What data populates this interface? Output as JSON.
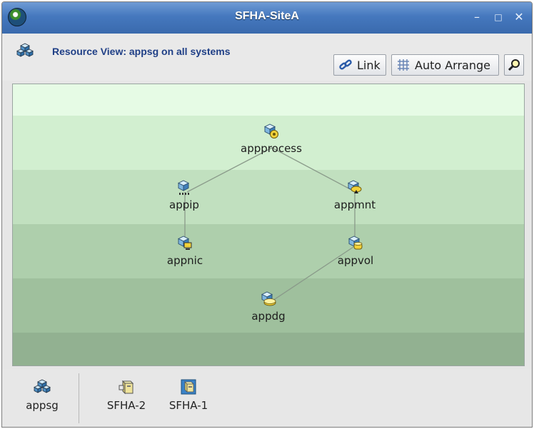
{
  "window": {
    "title": "SFHA-SiteA",
    "minimize_glyph": "–",
    "maximize_glyph": "□",
    "close_glyph": "✕"
  },
  "header": {
    "title": "Resource View: appsg on all systems",
    "icon": "service-group-icon"
  },
  "toolbar": {
    "link_label": "Link",
    "auto_arrange_label": "Auto Arrange",
    "find_icon": "magnifier-icon"
  },
  "graph": {
    "nodes": [
      {
        "id": "appprocess",
        "label": "appprocess",
        "icon": "process-resource-icon"
      },
      {
        "id": "appip",
        "label": "appip",
        "icon": "ip-resource-icon"
      },
      {
        "id": "appmnt",
        "label": "appmnt",
        "icon": "mount-resource-icon"
      },
      {
        "id": "appnic",
        "label": "appnic",
        "icon": "nic-resource-icon"
      },
      {
        "id": "appvol",
        "label": "appvol",
        "icon": "volume-resource-icon"
      },
      {
        "id": "appdg",
        "label": "appdg",
        "icon": "diskgroup-resource-icon"
      }
    ],
    "edges": [
      [
        "appprocess",
        "appip"
      ],
      [
        "appprocess",
        "appmnt"
      ],
      [
        "appip",
        "appnic"
      ],
      [
        "appmnt",
        "appvol"
      ],
      [
        "appvol",
        "appdg"
      ]
    ],
    "colors": {
      "edge": "#8a9a8a",
      "cube_top": "#d8eefc",
      "cube_side": "#5a9ed0",
      "badge": "#f2d23a"
    }
  },
  "tray": {
    "group": {
      "label": "appsg",
      "icon": "service-group-icon"
    },
    "systems": [
      {
        "label": "SFHA-2",
        "icon": "system-icon",
        "state": "inactive"
      },
      {
        "label": "SFHA-1",
        "icon": "system-icon",
        "state": "active"
      }
    ]
  }
}
